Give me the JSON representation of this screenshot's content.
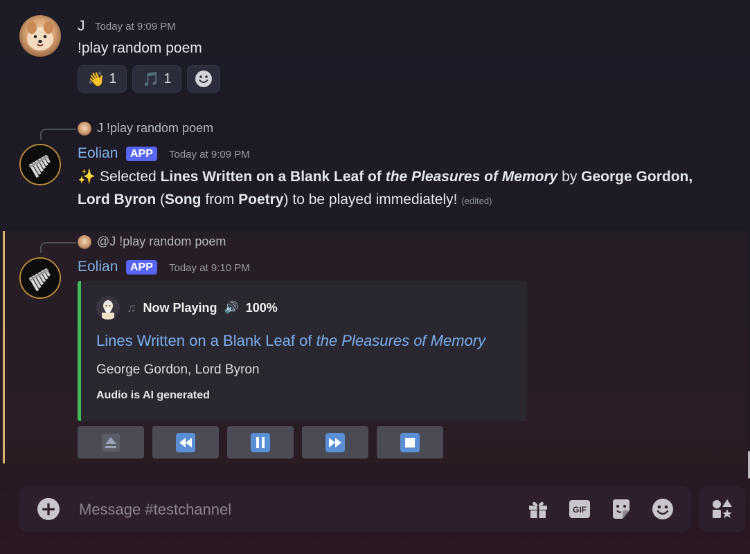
{
  "messages": {
    "m1": {
      "username": "J",
      "timestamp": "Today at 9:09 PM",
      "text": "!play random poem",
      "reactions": [
        {
          "emoji": "👋",
          "count": "1"
        },
        {
          "emoji": "🎵",
          "count": "1"
        }
      ],
      "add_reaction_icon": "smiley-icon"
    },
    "m2": {
      "reply_text": "J !play random poem",
      "username": "Eolian",
      "badge": "APP",
      "timestamp": "Today at 9:09 PM",
      "emoji": "✨",
      "parts": {
        "p1": "Selected ",
        "p2": "Lines Written on a Blank Leaf of ",
        "p3": "the Pleasures of Memory",
        "p4": " by ",
        "p5": "George Gordon, Lord Byron",
        "p6": " (",
        "p7": "Song",
        "p8": " from ",
        "p9": "Poetry",
        "p10": ") to be played immediately!"
      },
      "edited": "(edited)"
    },
    "m3": {
      "reply_text": "@J !play random poem",
      "username": "Eolian",
      "badge": "APP",
      "timestamp": "Today at 9:10 PM",
      "embed": {
        "author": "Now Playing",
        "volume": "100%",
        "title_plain": "Lines Written on a Blank Leaf of ",
        "title_italic": "the Pleasures of Memory",
        "description": "George Gordon, Lord Byron",
        "footer": "Audio is AI generated",
        "accent_color": "#43b95a"
      },
      "controls": [
        "eject-icon",
        "rewind-icon",
        "pause-icon",
        "fast-forward-icon",
        "stop-icon"
      ]
    }
  },
  "composer": {
    "placeholder": "Message #testchannel",
    "icons": [
      "add-icon",
      "gift-icon",
      "gif-icon",
      "sticker-icon",
      "emoji-icon",
      "apps-icon"
    ]
  },
  "colors": {
    "brand": "#5865f2",
    "bot_name": "#7fb0e8",
    "link": "#79aef0"
  }
}
